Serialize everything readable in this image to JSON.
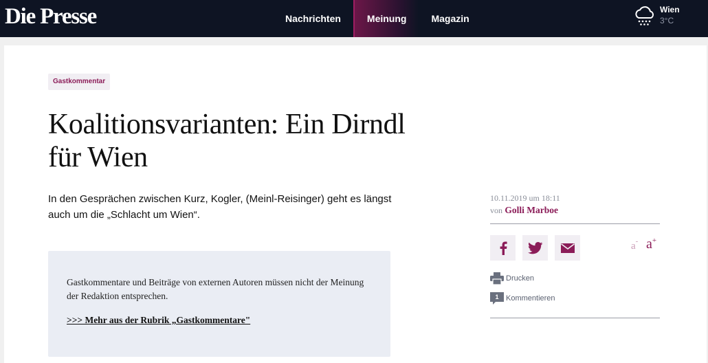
{
  "header": {
    "logo": "Die Presse",
    "nav": [
      {
        "label": "Nachrichten",
        "active": false
      },
      {
        "label": "Meinung",
        "active": true
      },
      {
        "label": "Magazin",
        "active": false
      }
    ],
    "weather": {
      "city": "Wien",
      "temp": "3°C",
      "icon": "snow-cloud-icon"
    }
  },
  "article": {
    "category": "Gastkommentar",
    "headline": "Koalitionsvarianten: Ein Dirndl für Wien",
    "lead": "In den Gesprächen zwischen Kurz, Kogler, (Meinl-Reisinger) geht es längst auch um die „Schlacht um Wien“.",
    "note": {
      "text": "Gastkommentare und Beiträge von externen Autoren müssen nicht der Meinung der Redaktion entsprechen.",
      "link": ">>> Mehr aus der Rubrik „Gastkommentare\""
    }
  },
  "sidebar": {
    "date": "10.11.2019 um 18:11",
    "by": "von",
    "author": "Golli Marboe",
    "share": [
      {
        "name": "facebook",
        "icon": "facebook-icon"
      },
      {
        "name": "twitter",
        "icon": "twitter-icon"
      },
      {
        "name": "email",
        "icon": "mail-icon"
      }
    ],
    "font_small": "a",
    "font_small_sign": "-",
    "font_large": "a",
    "font_large_sign": "+",
    "print_label": "Drucken",
    "comment_label": "Kommentieren",
    "comment_count": "1"
  },
  "colors": {
    "topbar": "#0e1423",
    "accent": "#8b1c58",
    "note_bg": "#eaedf4"
  }
}
